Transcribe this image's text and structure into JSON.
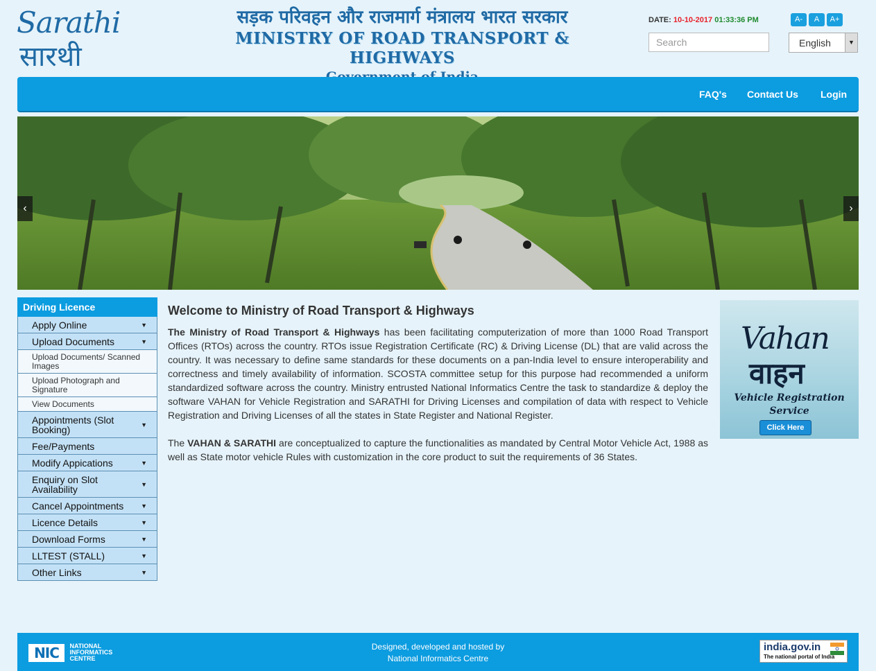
{
  "header": {
    "logo_en": "Sarathi",
    "logo_hi": "सारथी",
    "ministry_hindi": "सड़क परिवहन और राजमार्ग मंत्रालय भारत सरकार",
    "ministry_english": "MINISTRY OF ROAD TRANSPORT & HIGHWAYS",
    "government": "Government of India",
    "date_label": "DATE:",
    "date_value": "10-10-2017",
    "time_value": "01:33:36 PM",
    "font_buttons": [
      "A-",
      "A",
      "A+"
    ],
    "search_placeholder": "Search",
    "language": "English"
  },
  "nav": {
    "items": [
      "FAQ's",
      "Contact Us",
      "Login"
    ]
  },
  "banner": {
    "prev": "‹",
    "next": "›"
  },
  "sidebar": {
    "title": "Driving Licence",
    "items": [
      {
        "label": "Apply Online"
      },
      {
        "label": "Upload Documents"
      },
      {
        "label": "Upload Documents/ Scanned Images"
      },
      {
        "label": "Upload Photograph and Signature"
      },
      {
        "label": "View Documents"
      },
      {
        "label": "Appointments (Slot Booking)"
      },
      {
        "label": "Fee/Payments"
      },
      {
        "label": "Modify Appications"
      },
      {
        "label": "Enquiry on Slot Availability"
      },
      {
        "label": "Cancel Appointments"
      },
      {
        "label": "Licence Details"
      },
      {
        "label": "Download Forms"
      },
      {
        "label": "LLTEST (STALL)"
      },
      {
        "label": "Other Links"
      }
    ]
  },
  "main": {
    "heading": "Welcome to Ministry of Road Transport & Highways",
    "p1_bold": "The Ministry of Road Transport & Highways",
    "p1_text": " has been facilitating computerization of more than 1000 Road Transport Offices (RTOs) across the country. RTOs issue Registration Certificate (RC) & Driving License (DL) that are valid across the country. It was necessary to define same standards for these documents on a pan-India level to ensure interoperability and correctness and timely availability of information. SCOSTA committee setup for this purpose had recommended a uniform standardized software across the country. Ministry entrusted National Informatics Centre the task to standardize & deploy the software VAHAN for Vehicle Registration and SARATHI for Driving Licenses and compilation of data with respect to Vehicle Registration and Driving Licenses of all the states in State Register and National Register.",
    "p2_pre": "The ",
    "p2_bold": "VAHAN & SARATHI",
    "p2_text": " are conceptualized to capture the functionalities as mandated by Central Motor Vehicle Act, 1988 as well as State motor vehicle Rules with customization in the core product to suit the requirements of 36 States."
  },
  "vahan": {
    "title_en": "Vahan",
    "title_hi": "वाहन",
    "subtitle_1": "Vehicle Registration",
    "subtitle_2": "Service",
    "button": "Click Here"
  },
  "footer": {
    "nic_logo": "NIC",
    "nic_line1": "NATIONAL",
    "nic_line2": "INFORMATICS",
    "nic_line3": "CENTRE",
    "credit_line1": "Designed, developed and hosted by",
    "credit_line2": "National Informatics Centre",
    "indiagov_title": "india.gov.in",
    "indiagov_sub": "The national portal of India"
  },
  "colors": {
    "accent": "#0c9ce0",
    "brand_blue": "#1f6aa5",
    "date": "#e8212b",
    "time": "#1e8a2e",
    "sidebar_item": "#c3e1f6"
  }
}
